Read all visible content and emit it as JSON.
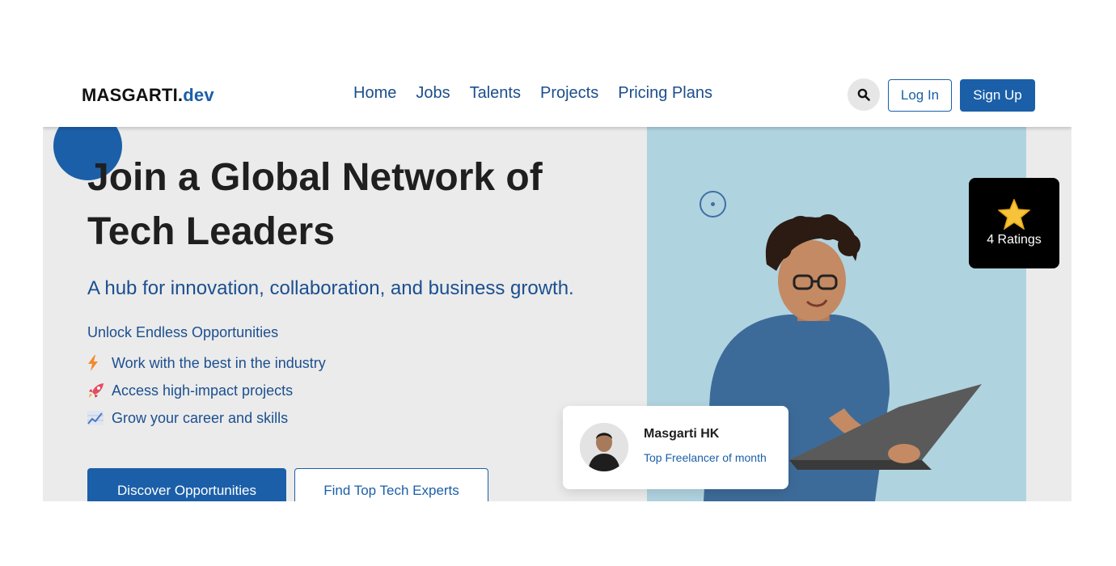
{
  "brand": {
    "name_main": "MASGARTI.",
    "name_accent": "dev",
    "accent_color": "#1b5fa8"
  },
  "nav": {
    "items": [
      {
        "label": "Home"
      },
      {
        "label": "Jobs"
      },
      {
        "label": "Talents"
      },
      {
        "label": "Projects"
      },
      {
        "label": "Pricing Plans"
      }
    ]
  },
  "header": {
    "search_icon": "search-icon",
    "login_label": "Log In",
    "signup_label": "Sign Up"
  },
  "hero": {
    "title": "Join a Global Network of Tech Leaders",
    "subtitle": "A hub for innovation, collaboration, and business growth.",
    "opportunities_heading": "Unlock Endless Opportunities",
    "opportunities": [
      {
        "icon": "lightning-icon",
        "text": "Work with the best in the industry"
      },
      {
        "icon": "rocket-icon",
        "text": "Access high-impact projects"
      },
      {
        "icon": "chart-icon",
        "text": "Grow your career and skills"
      }
    ],
    "primary_cta": "Discover Opportunities",
    "secondary_cta": "Find Top Tech Experts"
  },
  "ratings": {
    "icon": "star-icon",
    "label": "4 Ratings"
  },
  "featured": {
    "name": "Masgarti HK",
    "role": "Top Freelancer of month"
  }
}
